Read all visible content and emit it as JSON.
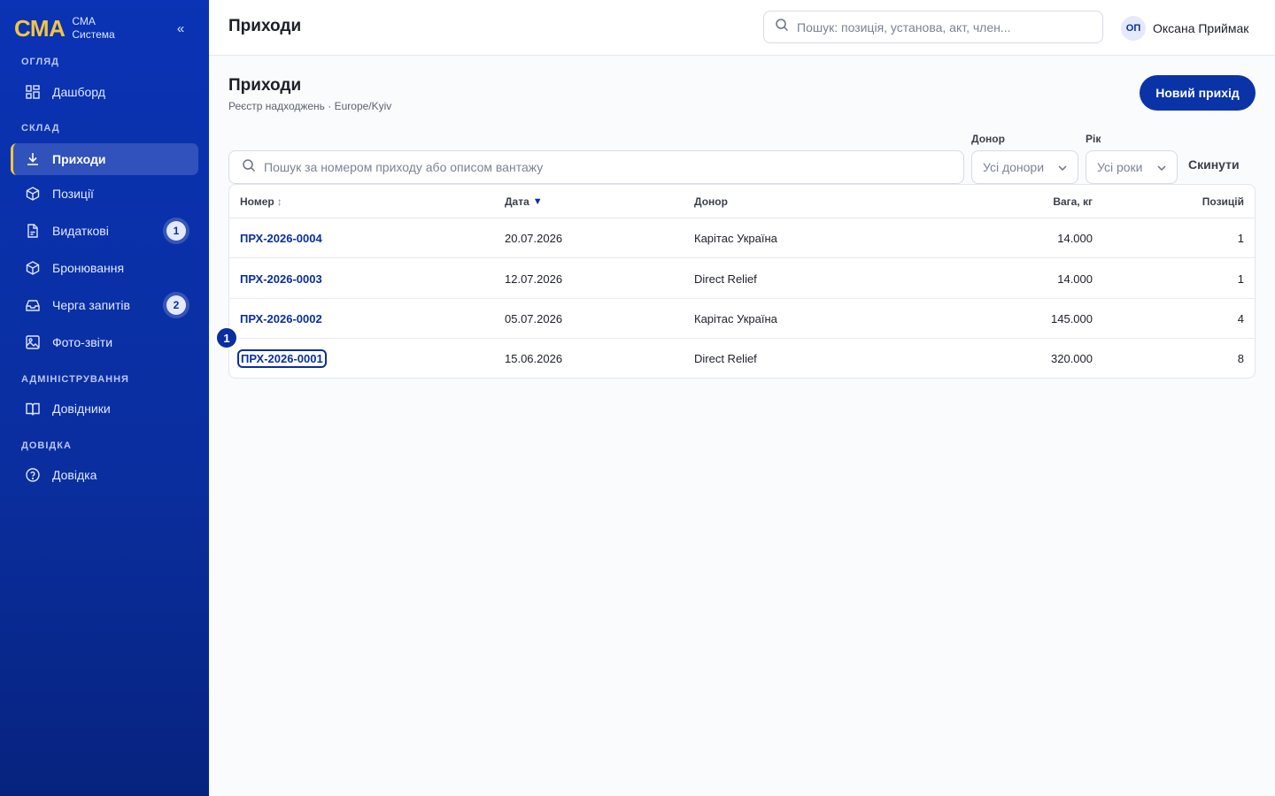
{
  "brand": {
    "logo": "СМА",
    "line1": "СМА",
    "line2": "Система",
    "collapse": "«"
  },
  "sidebar": {
    "sections": [
      {
        "label": "ОГЛЯД"
      },
      {
        "label": "СКЛАД"
      },
      {
        "label": "АДМІНІСТРУВАННЯ"
      },
      {
        "label": "ДОВІДКА"
      }
    ],
    "items": [
      {
        "label": "Дашборд",
        "icon": "grid-icon"
      },
      {
        "label": "Приходи",
        "icon": "download-icon",
        "active": true
      },
      {
        "label": "Позиції",
        "icon": "box-icon"
      },
      {
        "label": "Видаткові",
        "icon": "document-icon",
        "badge": "1"
      },
      {
        "label": "Бронювання",
        "icon": "box-icon"
      },
      {
        "label": "Черга запитів",
        "icon": "inbox-icon",
        "badge": "2"
      },
      {
        "label": "Фото-звіти",
        "icon": "image-icon"
      },
      {
        "label": "Довідники",
        "icon": "book-icon"
      },
      {
        "label": "Довідка",
        "icon": "help-circle-icon"
      }
    ]
  },
  "header": {
    "title": "Приходи",
    "search_placeholder": "Пошук: позиція, установа, акт, член...",
    "user_initials": "ОП",
    "user_name": "Оксана Приймак"
  },
  "main": {
    "title": "Приходи",
    "subtitle": "Реєстр надходжень · Europe/Kyiv",
    "new_button": "Новий прихід",
    "search_placeholder": "Пошук за номером приходу або описом вантажу",
    "donor_label": "Донор",
    "donor_value": "Усі донори",
    "year_label": "Рік",
    "year_value": "Усі роки",
    "reset": "Скинути",
    "marker": "1"
  },
  "table": {
    "columns": [
      "Номер",
      "Дата",
      "Донор",
      "Вага, кг",
      "Позицій"
    ],
    "sort_unsorted": "↕",
    "sort_desc": "▼",
    "rows": [
      {
        "number": "ПРХ-2026-0004",
        "date": "20.07.2026",
        "donor": "Карітас Україна",
        "weight": "14.000",
        "positions": "1"
      },
      {
        "number": "ПРХ-2026-0003",
        "date": "12.07.2026",
        "donor": "Direct Relief",
        "weight": "14.000",
        "positions": "1"
      },
      {
        "number": "ПРХ-2026-0002",
        "date": "05.07.2026",
        "donor": "Карітас Україна",
        "weight": "145.000",
        "positions": "4"
      },
      {
        "number": "ПРХ-2026-0001",
        "date": "15.06.2026",
        "donor": "Direct Relief",
        "weight": "320.000",
        "positions": "8"
      }
    ]
  },
  "colors": {
    "sidebar": "#0a33b5",
    "accent": "#f2c542",
    "primary": "#0a33a8"
  }
}
